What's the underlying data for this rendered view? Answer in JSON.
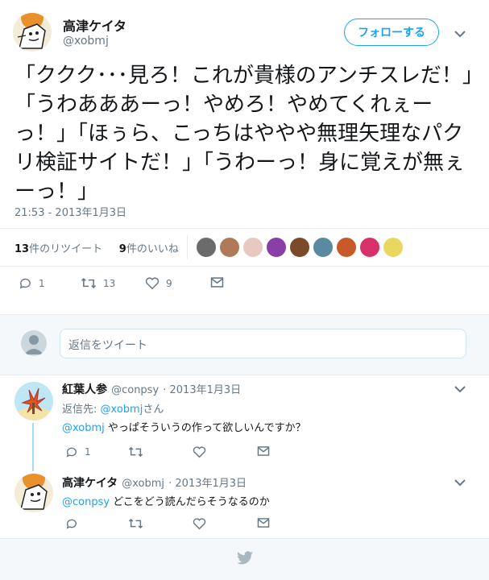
{
  "main_tweet": {
    "display_name": "高津ケイタ",
    "handle": "@xobmj",
    "follow_label": "フォローする",
    "text": "「ククク･･･見ろ！これが貴様のアンチスレだ！」「うわあああーっ！やめろ！やめてくれぇーっ！」「ほぅら、こっちはややや無理矢理なパクリ検証サイトだ！」「うわーっ！身に覚えが無ぇーっ！」",
    "timestamp": "21:53 - 2013年1月3日",
    "retweet_count": "13",
    "retweet_label": "件のリツイート",
    "like_count": "9",
    "like_label": "件のいいね",
    "actions": {
      "reply_count": "1",
      "retweet_count": "13",
      "like_count": "9"
    }
  },
  "liker_colors": [
    "#6b6b6b",
    "#b07a58",
    "#e8c9c2",
    "#8a3fa8",
    "#7a4a2a",
    "#5a8aa0",
    "#c85a2a",
    "#d8306a",
    "#e8d860"
  ],
  "reply_box": {
    "placeholder": "返信をツイート"
  },
  "replies": [
    {
      "display_name": "紅葉人参",
      "handle": "@conpsy",
      "date": "2013年1月3日",
      "replying_prefix": "返信先:",
      "replying_to": "@xobmj",
      "replying_suffix": "さん",
      "mention": "@xobmj",
      "text": " やっぱそういうの作って欲しいんですか？",
      "reply_count": "1"
    },
    {
      "display_name": "高津ケイタ",
      "handle": "@xobmj",
      "date": "2013年1月3日",
      "mention": "@conpsy",
      "text": " どこをどう読んだらそうなるのか"
    }
  ],
  "colors": {
    "accent": "#1da1f2",
    "muted": "#657786",
    "text": "#14171a",
    "thread_line": "#aad8f7"
  }
}
